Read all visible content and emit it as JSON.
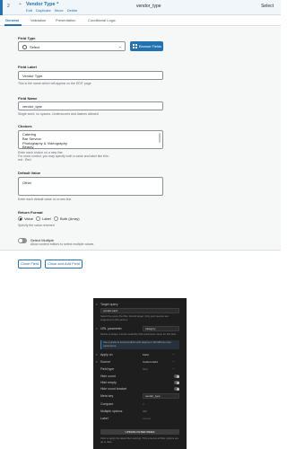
{
  "field_row": {
    "order": "2",
    "label": "Vendor Type *",
    "actions": [
      "Edit",
      "Duplicate",
      "Move",
      "Delete"
    ],
    "name": "vendor_type",
    "type": "Select"
  },
  "tabs": [
    "General",
    "Validation",
    "Presentation",
    "Conditional Logic"
  ],
  "field_type": {
    "label": "Field Type",
    "value": "Select",
    "browse_label": "Browse Fields"
  },
  "field_label": {
    "label": "Field Label",
    "value": "Vendor Type",
    "instructions": "This is the name which will appear on the EDIT page"
  },
  "field_name": {
    "label": "Field Name",
    "value": "vendor_type",
    "instructions": "Single word, no spaces. Underscores and dashes allowed"
  },
  "choices": {
    "label": "Choices",
    "lines": [
      "Catering",
      "Bar Service",
      "Photography & Videography",
      "Beauty"
    ],
    "instructions": [
      "Enter each choice on a new line.",
      "For more control, you may specify both a value and label like this:",
      "red : Red"
    ]
  },
  "default_value": {
    "label": "Default Value",
    "value": "Other",
    "instructions": "Enter each default value on a new line"
  },
  "return_format": {
    "label": "Return Format",
    "options": [
      "Value",
      "Label",
      "Both (Array)"
    ],
    "selected": "Value",
    "instructions": "Specify the value returned"
  },
  "select_multiple": {
    "label": "Select Multiple",
    "instructions": "Allow content editors to select multiple values"
  },
  "footer": {
    "close_label": "Close Field",
    "close_add_label": "Close and Add Field"
  },
  "filter_panel": {
    "target_query_label": "Target query",
    "target_query_value": "vendor-card",
    "target_query_help": "Select the query the filter should target. Only post queries are supported in this version.",
    "url_param_label": "URL parameter",
    "url_param_value": "category",
    "url_param_help": "Define a unique, human-readable URL parameter name for this filter.",
    "url_note": "Use a prefix to avoid conflicts with plugins or WordPress core parameters.",
    "apply_on_label": "Apply on",
    "apply_on_value": "Field",
    "source_label": "Source",
    "source_value": "Custom field",
    "field_type_label": "Field type",
    "field_type_value": "Text",
    "hide_count_label": "Hide count",
    "hide_empty_label": "Hide empty",
    "hide_count_bracket_label": "Hide count bracket",
    "meta_key_label": "Meta key",
    "meta_key_value": "vendor_type",
    "compare_label": "Compare",
    "compare_value": "=",
    "multiple_options_label": "Multiple options",
    "multiple_options_value": "OR",
    "label_label": "Label",
    "label_placeholder": "Vendor",
    "update_button": "UPDATE FILTER INDEX",
    "update_help": "Click to apply the latest filter settings. This ensures all filter options are up to date."
  }
}
